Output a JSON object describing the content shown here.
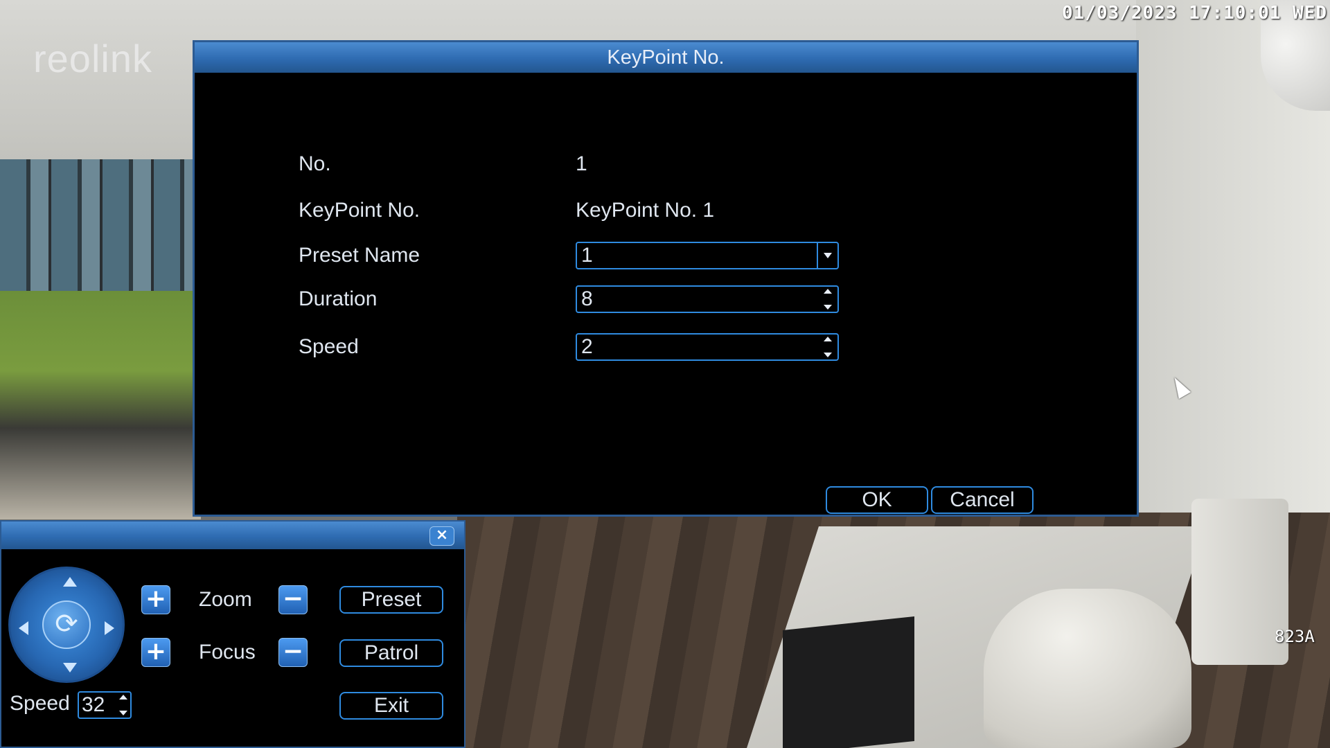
{
  "overlay": {
    "brand": "reolink",
    "datetime": "01/03/2023 17:10:01 WED",
    "camera_label": "823A"
  },
  "dialog": {
    "title": "KeyPoint No.",
    "fields": {
      "no_label": "No.",
      "no_value": "1",
      "keypoint_label": "KeyPoint No.",
      "keypoint_value": "KeyPoint No. 1",
      "preset_label": "Preset Name",
      "preset_value": "1",
      "duration_label": "Duration",
      "duration_value": "8",
      "speed_label": "Speed",
      "speed_value": "2"
    },
    "ok_label": "OK",
    "cancel_label": "Cancel"
  },
  "ptz": {
    "close_label": "×",
    "zoom_label": "Zoom",
    "focus_label": "Focus",
    "preset_label": "Preset",
    "patrol_label": "Patrol",
    "exit_label": "Exit",
    "speed_label": "Speed",
    "speed_value": "32"
  },
  "icons": {
    "joystick_center": "rotate-icon",
    "plus": "plus-icon",
    "minus": "minus-icon"
  },
  "colors": {
    "accent": "#2f8be0",
    "titlebar": "#2e6bb1"
  }
}
